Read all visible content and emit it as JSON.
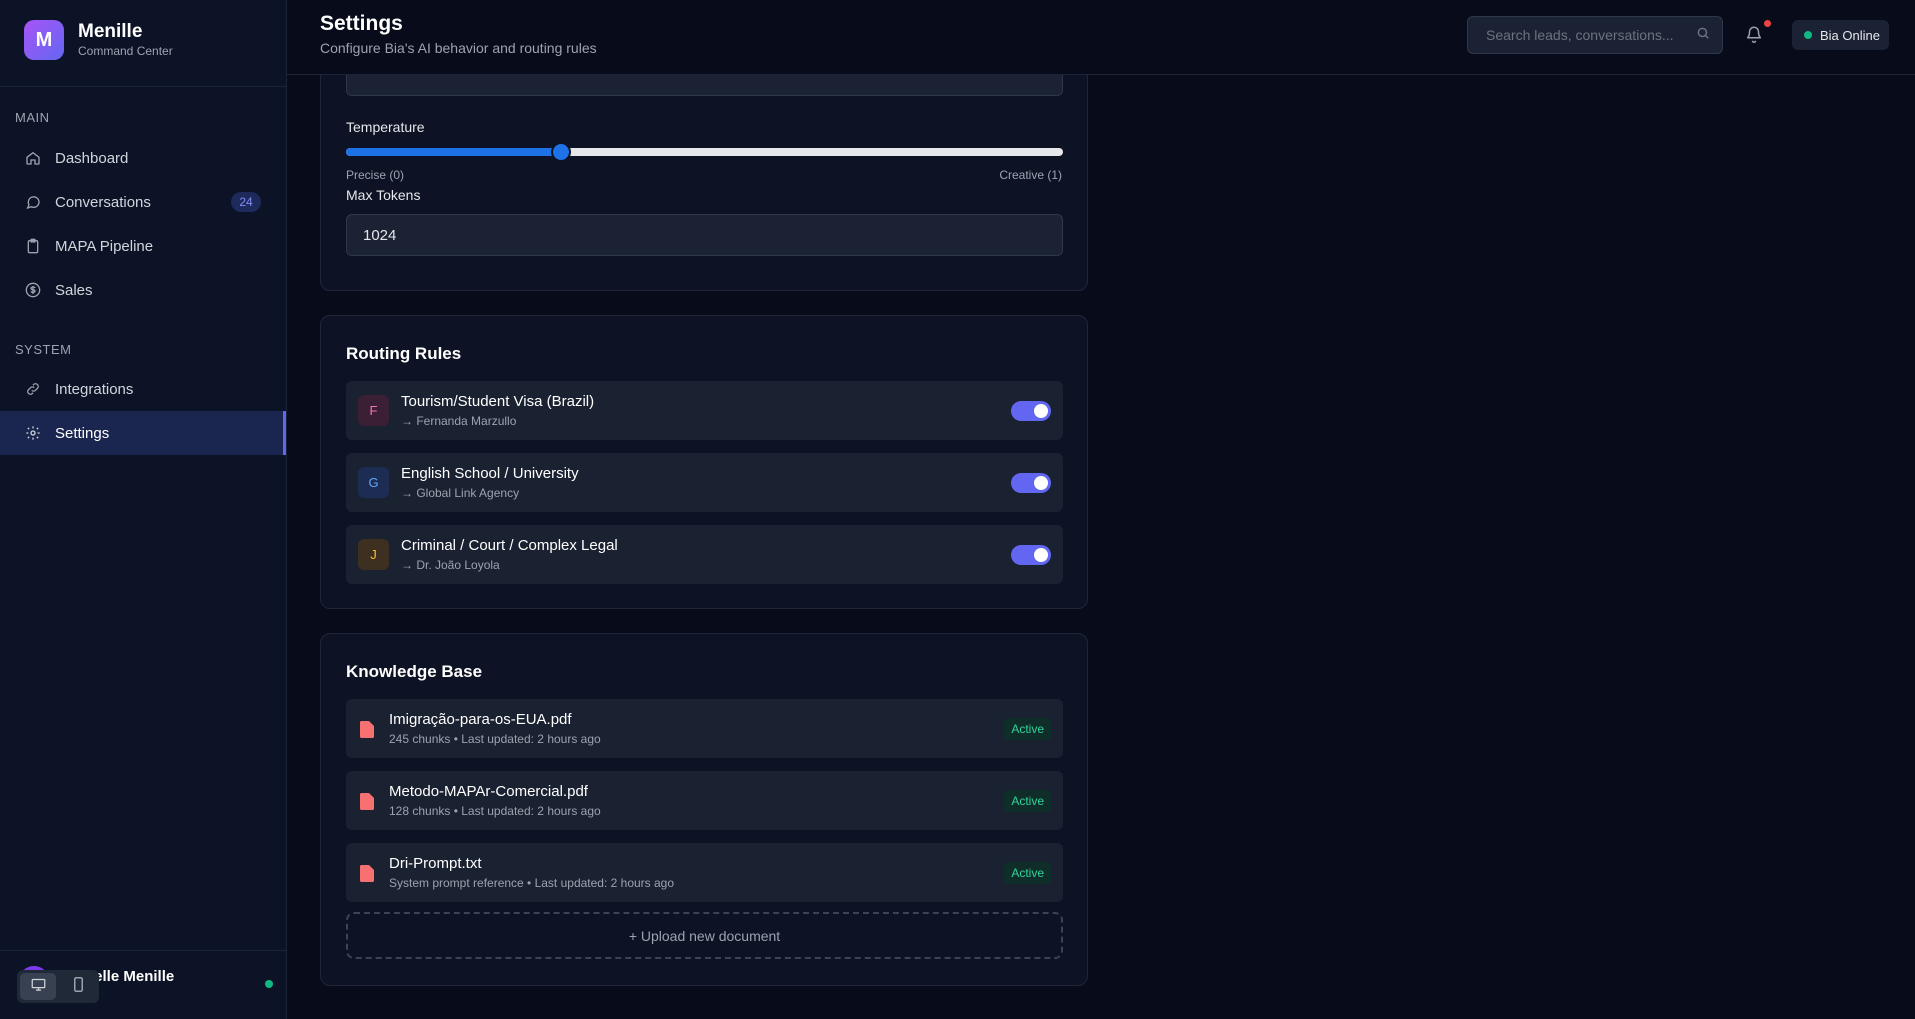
{
  "brand": {
    "initial": "M",
    "name": "Menille",
    "subtitle": "Command Center"
  },
  "sidebar": {
    "sections": [
      {
        "title": "MAIN"
      },
      {
        "title": "SYSTEM"
      }
    ],
    "items": [
      {
        "label": "Dashboard",
        "icon": "home-icon"
      },
      {
        "label": "Conversations",
        "icon": "chat-icon",
        "badge": "24"
      },
      {
        "label": "MAPA Pipeline",
        "icon": "clipboard-icon"
      },
      {
        "label": "Sales",
        "icon": "dollar-icon"
      },
      {
        "label": "Integrations",
        "icon": "link-icon"
      },
      {
        "label": "Settings",
        "icon": "gear-icon",
        "active": true
      }
    ],
    "user": {
      "name": "Ielle Menille",
      "status": "online"
    },
    "device_toggle": {
      "options": [
        "desktop-icon",
        "mobile-icon"
      ],
      "selected": "desktop"
    }
  },
  "header": {
    "title": "Settings",
    "subtitle": "Configure Bia's AI behavior and routing rules",
    "search_placeholder": "Search leads, conversations...",
    "status_label": "Bia Online"
  },
  "ai_settings": {
    "temperature_label": "Temperature",
    "temperature_value": 0.3,
    "temperature_min_label": "Precise (0)",
    "temperature_max_label": "Creative (1)",
    "max_tokens_label": "Max Tokens",
    "max_tokens_value": "1024"
  },
  "routing": {
    "title": "Routing Rules",
    "rules": [
      {
        "initial": "F",
        "name": "Tourism/Student Visa (Brazil)",
        "target": "→ Fernanda Marzullo",
        "enabled": true,
        "color": "#f472b6",
        "bg": "#3a1f35"
      },
      {
        "initial": "G",
        "name": "English School / University",
        "target": "→ Global Link Agency",
        "enabled": true,
        "color": "#60a5fa",
        "bg": "#1d2c52"
      },
      {
        "initial": "J",
        "name": "Criminal / Court / Complex Legal",
        "target": "→ Dr. João Loyola",
        "enabled": true,
        "color": "#fbbf24",
        "bg": "#3d3020"
      }
    ]
  },
  "knowledge_base": {
    "title": "Knowledge Base",
    "documents": [
      {
        "name": "Imigração-para-os-EUA.pdf",
        "meta": "245 chunks • Last updated: 2 hours ago",
        "status": "Active"
      },
      {
        "name": "Metodo-MAPAr-Comercial.pdf",
        "meta": "128 chunks • Last updated: 2 hours ago",
        "status": "Active"
      },
      {
        "name": "Dri-Prompt.txt",
        "meta": "System prompt reference • Last updated: 2 hours ago",
        "status": "Active"
      }
    ],
    "upload_label": "+ Upload new document"
  },
  "colors": {
    "accent": "#6366f1",
    "slider": "#1d72e8",
    "success": "#10b981",
    "danger": "#ef4444",
    "file_icon": "#f87171"
  }
}
